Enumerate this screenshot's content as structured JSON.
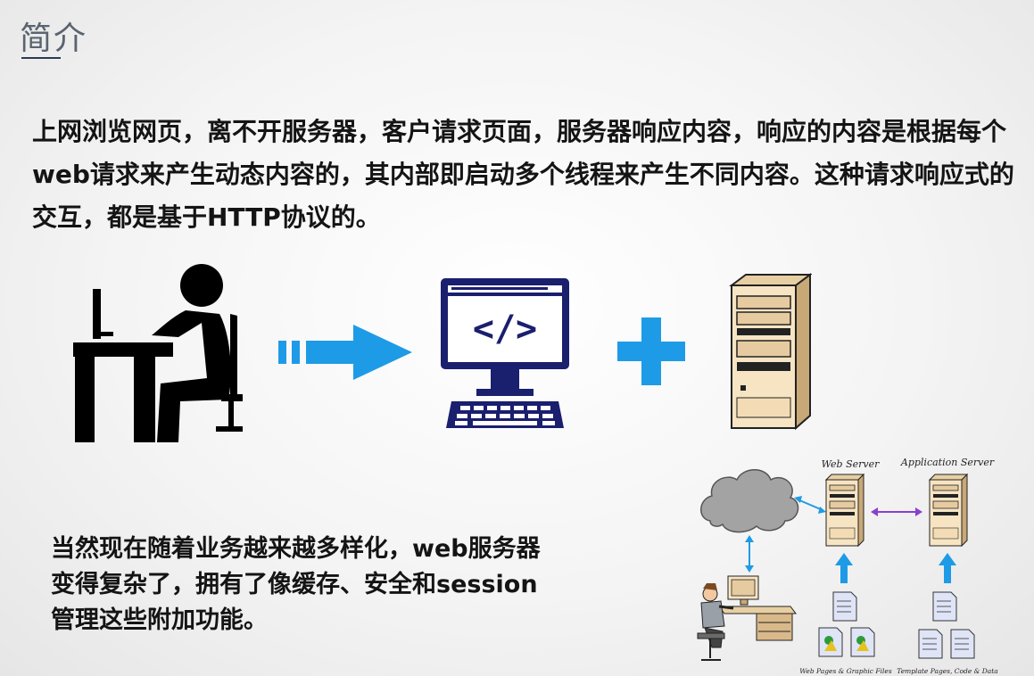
{
  "slide": {
    "title": "简介",
    "paragraph1": "上网浏览网页，离不开服务器，客户请求页面，服务器响应内容，响应的内容是根据每个web请求来产生动态内容的，其内部即启动多个线程来产生不同内容。这种请求响应式的交互，都是基于HTTP协议的。",
    "paragraph2_lines": [
      "当然现在随着业务越来越多样化，web服务器",
      "变得复杂了，拥有了像缓存、安全和session",
      "管理这些附加功能。"
    ]
  },
  "diagram": {
    "web_server_label": "Web Server",
    "app_server_label": "Application Server",
    "web_files_label": "Web Pages & Graphic Files",
    "template_label": "Template Pages, Code & Data",
    "code_symbol": "</>"
  },
  "colors": {
    "accent_blue": "#1e9be6",
    "navy": "#1a1f6e",
    "server_beige": "#f7e4c3",
    "purple_arrow": "#8a3fcf"
  }
}
